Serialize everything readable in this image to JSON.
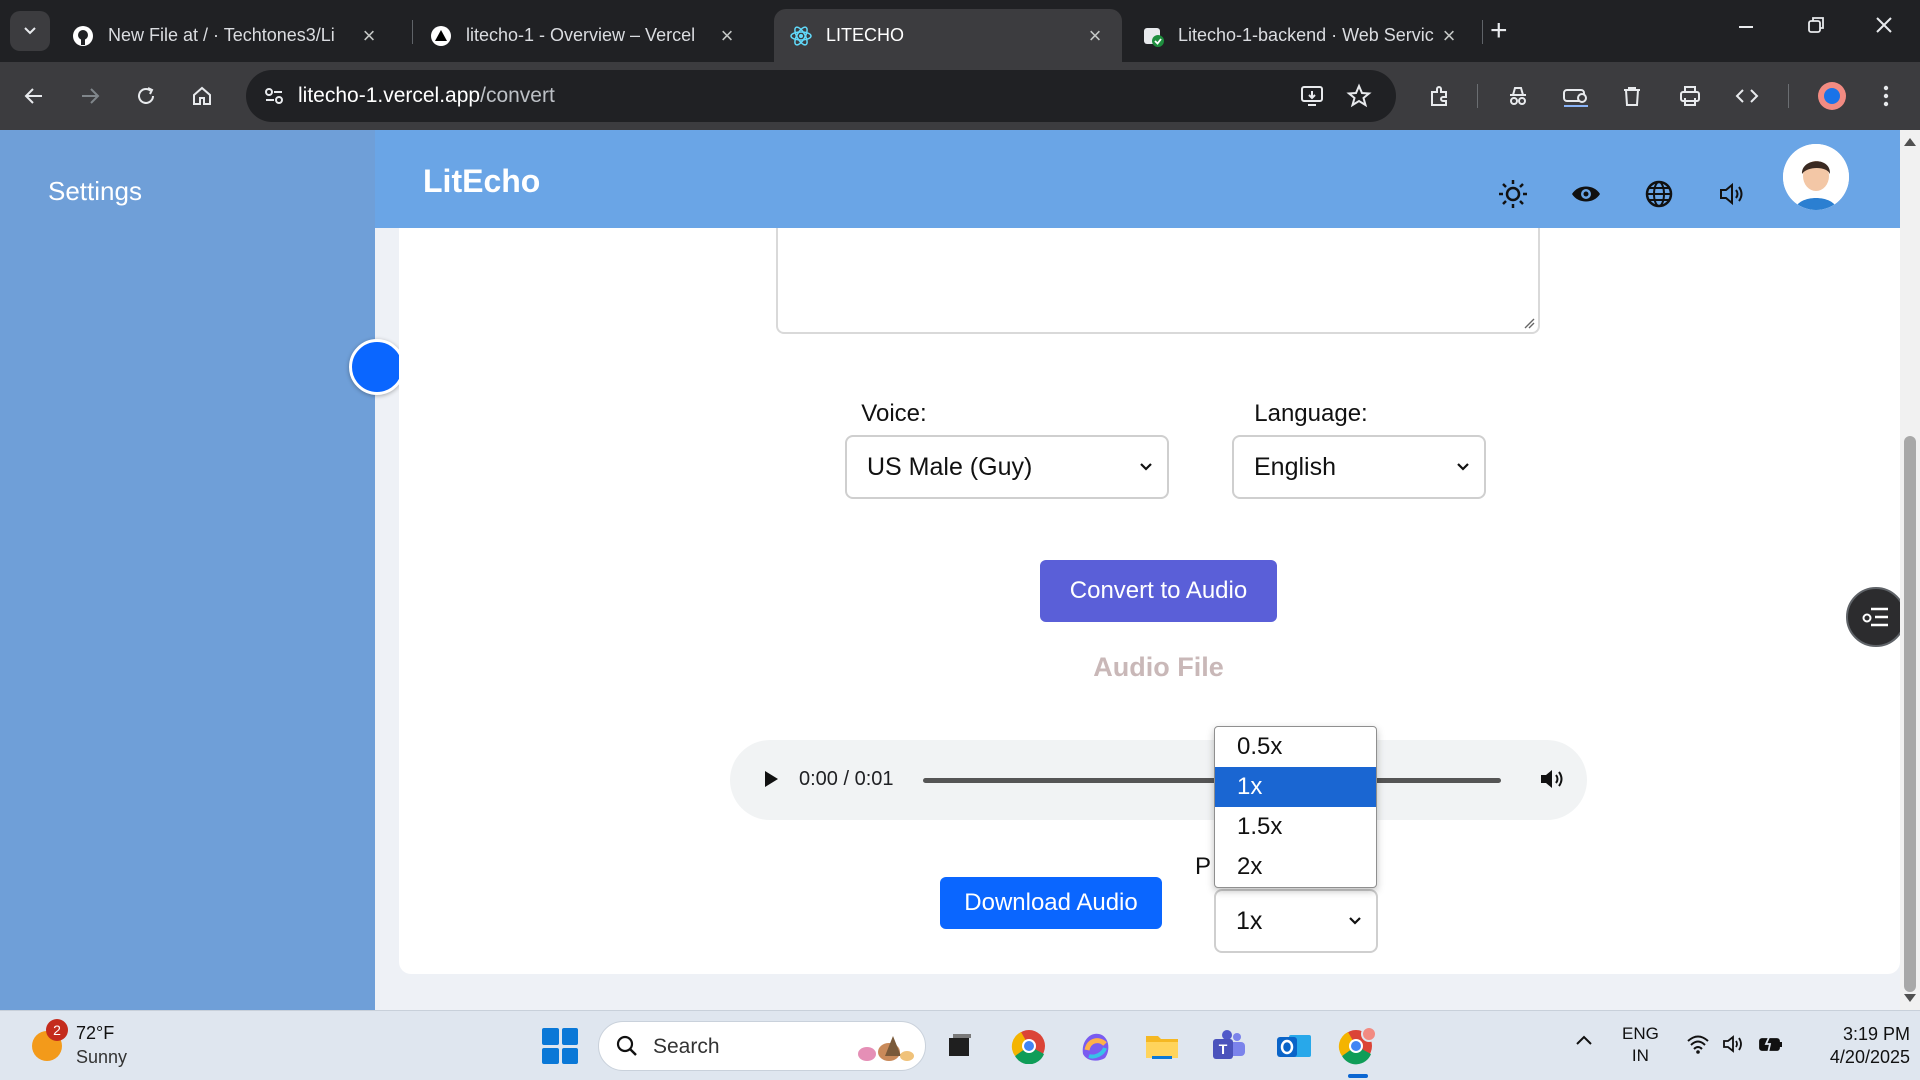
{
  "browser": {
    "tabs": [
      {
        "title": "New File at / · Techtones3/Li",
        "icon": "github-icon"
      },
      {
        "title": "litecho-1 - Overview – Vercel",
        "icon": "vercel-icon"
      },
      {
        "title": "LITECHO",
        "icon": "react-icon",
        "active": true
      },
      {
        "title": "Litecho-1-backend · Web Servic",
        "icon": "render-icon"
      }
    ],
    "url_host": "litecho-1.vercel.app",
    "url_path": "/convert"
  },
  "sidebar": {
    "title": "Settings"
  },
  "header": {
    "brand": "LitEcho",
    "icons": [
      "sun-icon",
      "eye-icon",
      "globe-icon",
      "speaker-icon"
    ]
  },
  "form": {
    "voice_label": "Voice:",
    "voice_value": "US Male (Guy)",
    "language_label": "Language:",
    "language_value": "English",
    "convert_button": "Convert to Audio"
  },
  "audio": {
    "title": "Audio File",
    "time": "0:00 / 0:01",
    "download_button": "Download Audio",
    "playback_label_partial": "P",
    "speed_value": "1x",
    "speed_options": [
      "0.5x",
      "1x",
      "1.5x",
      "2x"
    ],
    "speed_selected_index": 1
  },
  "taskbar": {
    "weather_badge": "2",
    "weather_temp": "72°F",
    "weather_desc": "Sunny",
    "search_placeholder": "Search",
    "lang_line1": "ENG",
    "lang_line2": "IN",
    "time": "3:19 PM",
    "date": "4/20/2025"
  },
  "colors": {
    "sidebar": "#6f9fd8",
    "header": "#6aa5e6",
    "convert_button": "#5a5fd8",
    "download_button": "#0a66ff",
    "selected_option": "#1a66d2"
  }
}
